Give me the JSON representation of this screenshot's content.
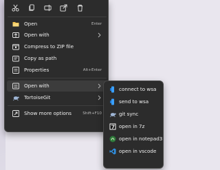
{
  "colors": {
    "menu_bg": "#2c2c2c",
    "text": "#f0f0f0",
    "shortcut": "#bdbdbd",
    "accent_blue": "#3aa0ff",
    "folder_yellow": "#f2c14e"
  },
  "toolbar": {
    "cut": "cut-icon",
    "copy": "copy-icon",
    "rename": "rename-icon",
    "share": "share-icon",
    "delete": "delete-icon"
  },
  "menu": {
    "items": [
      {
        "label": "Open",
        "shortcut": "Enter",
        "icon": "open-folder-icon"
      },
      {
        "label": "Open with",
        "shortcut": "",
        "icon": "open-with-icon",
        "has_submenu": true
      },
      {
        "label": "Compress to ZIP file",
        "shortcut": "",
        "icon": "zip-icon"
      },
      {
        "label": "Copy as path",
        "shortcut": "",
        "icon": "copy-path-icon"
      },
      {
        "label": "Properties",
        "shortcut": "Alt+Enter",
        "icon": "properties-icon"
      },
      {
        "label": "Open with",
        "shortcut": "",
        "icon": "open-with-icon",
        "has_submenu": true,
        "highlighted": true
      },
      {
        "label": "TortoiseGit",
        "shortcut": "",
        "icon": "tortoisegit-icon",
        "has_submenu": true
      },
      {
        "label": "Show more options",
        "shortcut": "Shift+F10",
        "icon": "more-options-icon"
      }
    ]
  },
  "submenu": {
    "items": [
      {
        "label": "connect to wsa",
        "icon": "wsa-icon"
      },
      {
        "label": "send to wsa",
        "icon": "wsa-icon"
      },
      {
        "label": "git sync",
        "icon": "tortoisegit-icon"
      },
      {
        "label": "open in 7z",
        "icon": "sevenzip-icon"
      },
      {
        "label": "open in notepad3",
        "icon": "notepad3-icon"
      },
      {
        "label": "open in vscode",
        "icon": "vscode-icon"
      }
    ]
  }
}
